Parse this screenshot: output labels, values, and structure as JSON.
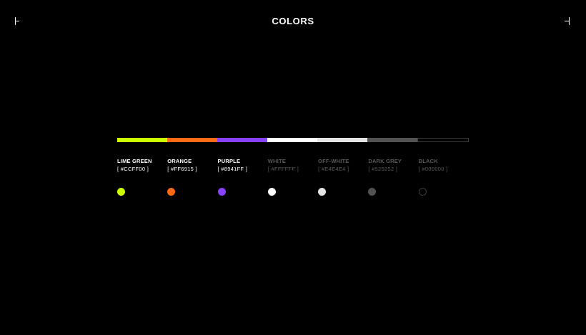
{
  "header": {
    "title": "COLORS"
  },
  "colors": [
    {
      "name": "LIME GREEN",
      "hex_label": "[ #CCFF00 ]",
      "value": "#CCFF00",
      "text_color": "#FFFFFF"
    },
    {
      "name": "ORANGE",
      "hex_label": "[ #FF6915 ]",
      "value": "#FF6915",
      "text_color": "#FFFFFF"
    },
    {
      "name": "PURPLE",
      "hex_label": "[ #8941FF ]",
      "value": "#8941FF",
      "text_color": "#FFFFFF"
    },
    {
      "name": "WHITE",
      "hex_label": "[ #FFFFFF ]",
      "value": "#FFFFFF",
      "text_color": "#5A5A5A"
    },
    {
      "name": "OFF-WHITE",
      "hex_label": "[ #E4E4E4 ]",
      "value": "#E4E4E4",
      "text_color": "#5A5A5A"
    },
    {
      "name": "DARK GREY",
      "hex_label": "[ #525252 ]",
      "value": "#525252",
      "text_color": "#5A5A5A"
    },
    {
      "name": "BLACK",
      "hex_label": "[ #000000 ]",
      "value": "#000000",
      "text_color": "#5A5A5A"
    }
  ],
  "icons": {
    "left_corner": "corner-bracket-left-icon",
    "right_corner": "corner-bracket-right-icon"
  },
  "border_color": "#3A3A3A"
}
